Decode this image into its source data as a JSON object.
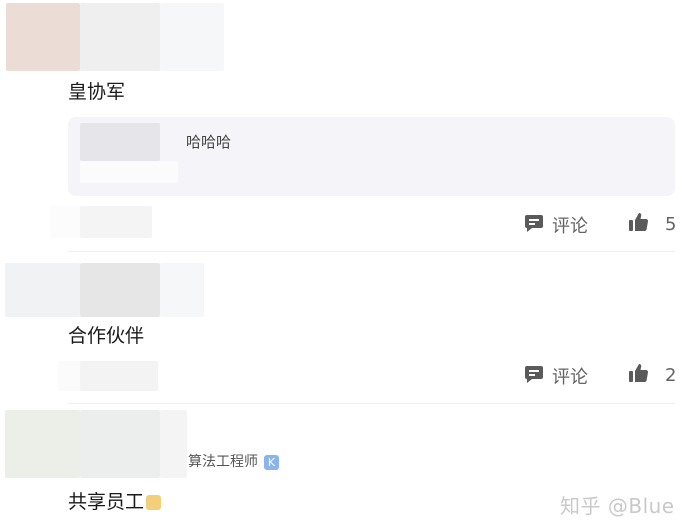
{
  "comments": [
    {
      "text": "皇协军",
      "quote": "哈哈哈",
      "actions": {
        "comment_label": "评论",
        "like_count": "5"
      }
    },
    {
      "text": "合作伙伴",
      "actions": {
        "comment_label": "评论",
        "like_count": "2"
      }
    },
    {
      "text": "共享员工",
      "meta": "算法工程师",
      "badge": "K"
    }
  ],
  "watermark": "知乎 @Blue",
  "colors": {
    "quote_bg": "#f4f4f9",
    "icon": "#5a5a5a",
    "text_muted": "#646464"
  },
  "icons": [
    "comment-icon",
    "thumbs-up-icon",
    "k-badge-icon",
    "emoji-icon"
  ]
}
